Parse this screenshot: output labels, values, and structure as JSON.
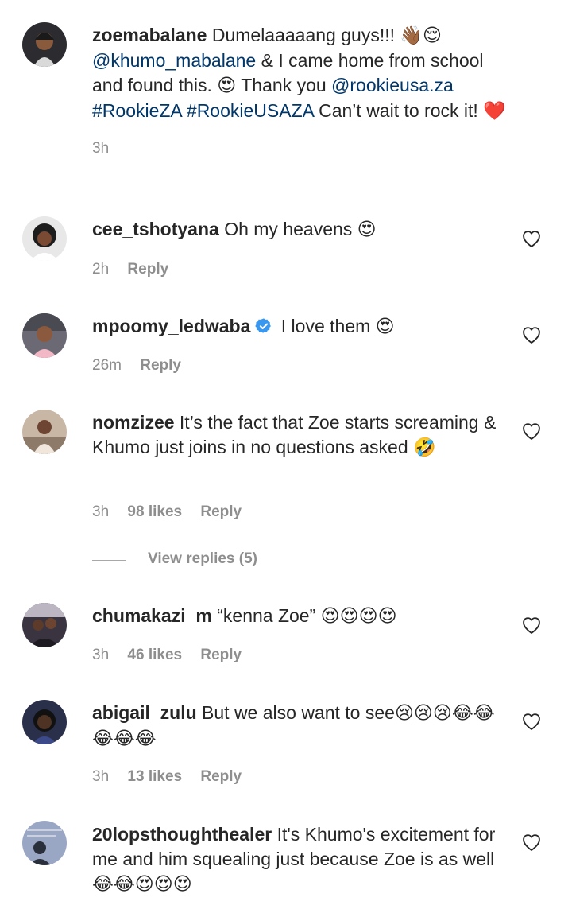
{
  "caption": {
    "username": "zoemabalane",
    "text_1": "Dumelaaaaang guys!!! ",
    "emoji_1": "👋🏾😌",
    "mention_1": "@khumo_mabalane",
    "text_2": " & I came home from school and found this. ",
    "emoji_2": "😍",
    "text_3": " Thank you ",
    "mention_2": "@rookieusa.za",
    "hashtag_1": "#RookieZA",
    "hashtag_2": "#RookieUSAZA",
    "text_4": " Can’t wait to rock it! ",
    "emoji_3": "❤️",
    "time": "3h"
  },
  "comments": [
    {
      "username": "cee_tshotyana",
      "text": "Oh my heavens ",
      "emoji": "😍",
      "time": "2h",
      "reply": "Reply"
    },
    {
      "username": "mpoomy_ledwaba",
      "text": "I love them ",
      "emoji": "😍",
      "time": "26m",
      "reply": "Reply"
    },
    {
      "username": "nomzizee",
      "text": "It’s the fact that Zoe starts screaming & Khumo just joins in no questions asked",
      "emoji": "🤣",
      "time": "3h",
      "likes": "98 likes",
      "reply": "Reply"
    },
    {
      "username": "chumakazi_m",
      "text": "“kenna Zoe” ",
      "emoji": "😍😍😍😍",
      "time": "3h",
      "likes": "46 likes",
      "reply": "Reply"
    },
    {
      "username": "abigail_zulu",
      "text": "But we also want to see",
      "emoji": "😢😢😢😂😂😂😂😂",
      "time": "3h",
      "likes": "13 likes",
      "reply": "Reply"
    },
    {
      "username": "20lopsthoughthealer",
      "text": "It's Khumo's excitement for me and him squealing just because Zoe is as well",
      "emoji": "😂😂😍😍😍"
    }
  ],
  "view_replies": "View replies (5)",
  "colors": {
    "link": "#00376b",
    "meta": "#8e8e8e",
    "text": "#262626",
    "verified": "#3897f0"
  }
}
